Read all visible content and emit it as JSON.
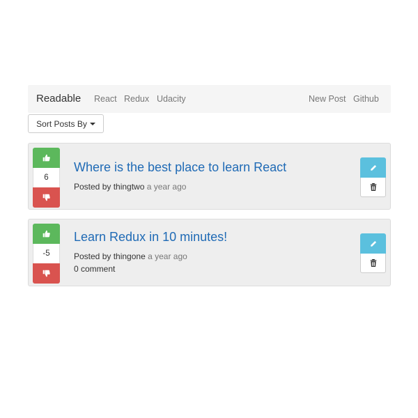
{
  "navbar": {
    "brand": "Readable",
    "links": [
      "React",
      "Redux",
      "Udacity"
    ],
    "right_links": [
      "New Post",
      "Github"
    ]
  },
  "sort": {
    "label": "Sort Posts By"
  },
  "posts": [
    {
      "score": "6",
      "title": "Where is the best place to learn React",
      "posted_by": "Posted by thingtwo",
      "time": "a year ago",
      "comments": ""
    },
    {
      "score": "-5",
      "title": "Learn Redux in 10 minutes!",
      "posted_by": "Posted by thingone",
      "time": "a year ago",
      "comments": "0 comment"
    }
  ],
  "icons": {
    "upvote": "thumbs-up-icon",
    "downvote": "thumbs-down-icon",
    "edit": "pencil-icon",
    "delete": "trash-icon"
  },
  "colors": {
    "upvote": "#5cb85c",
    "downvote": "#d9534f",
    "edit": "#5bc0de",
    "title_link": "#1f6ab5",
    "navbar_bg": "#f5f5f5",
    "card_bg": "#eeeeee"
  }
}
